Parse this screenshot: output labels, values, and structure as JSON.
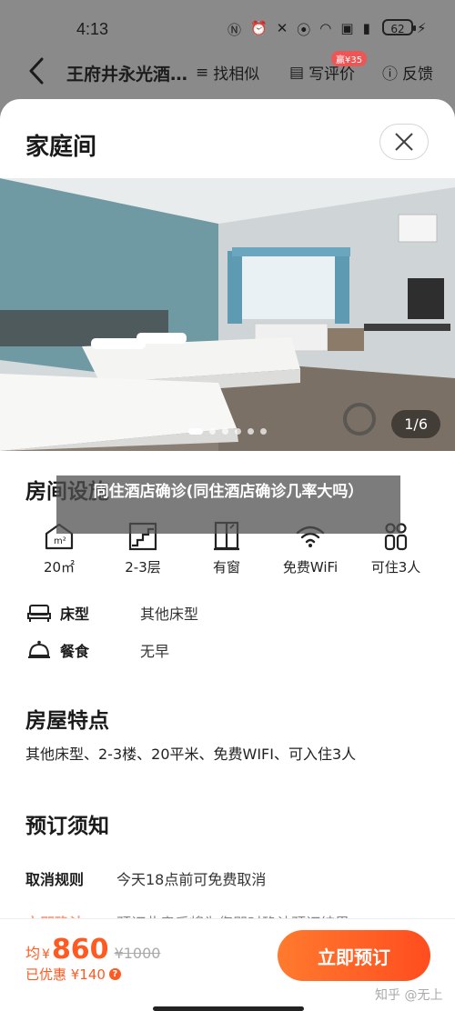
{
  "status_bar": {
    "time": "4:13",
    "battery": "62"
  },
  "nav": {
    "back_icon": "chevron-left-icon",
    "title": "王府井永光酒…",
    "actions": [
      {
        "label": "找相似",
        "icon": "find-similar-icon"
      },
      {
        "label": "写评价",
        "icon": "review-icon",
        "badge": "赢¥35"
      },
      {
        "label": "反馈",
        "icon": "feedback-icon"
      }
    ]
  },
  "sheet": {
    "title": "家庭间",
    "photo": {
      "counter": "1/6"
    }
  },
  "overlay": {
    "text": "同住酒店确诊(同住酒店确诊几率大吗）"
  },
  "facilities": {
    "title": "房间设施",
    "items": [
      {
        "label": "20㎡",
        "icon": "area-icon"
      },
      {
        "label": "2-3层",
        "icon": "stairs-icon"
      },
      {
        "label": "有窗",
        "icon": "window-icon"
      },
      {
        "label": "免费WiFi",
        "icon": "wifi-icon"
      },
      {
        "label": "可住3人",
        "icon": "people-icon"
      }
    ],
    "bed": {
      "key": "床型",
      "value": "其他床型"
    },
    "meal": {
      "key": "餐食",
      "value": "无早"
    }
  },
  "features": {
    "title": "房屋特点",
    "text": "其他床型、2-3楼、20平米、免费WIFI、可入住3人"
  },
  "notice": {
    "title": "预订须知",
    "rows": [
      {
        "key": "取消规则",
        "value": "今天18点前可免费取消"
      },
      {
        "key": "立即确认",
        "value": "预订此房后将为您即时确认预订结果"
      }
    ]
  },
  "bottom": {
    "prefix": "均",
    "currency": "¥",
    "price": "860",
    "original": "¥1000",
    "discount": "已优惠 ¥140",
    "book_label": "立即预订",
    "watermark": "知乎 @无上"
  },
  "colors": {
    "accent": "#ff5a22",
    "dim_overlay": "#8a8a8a"
  }
}
